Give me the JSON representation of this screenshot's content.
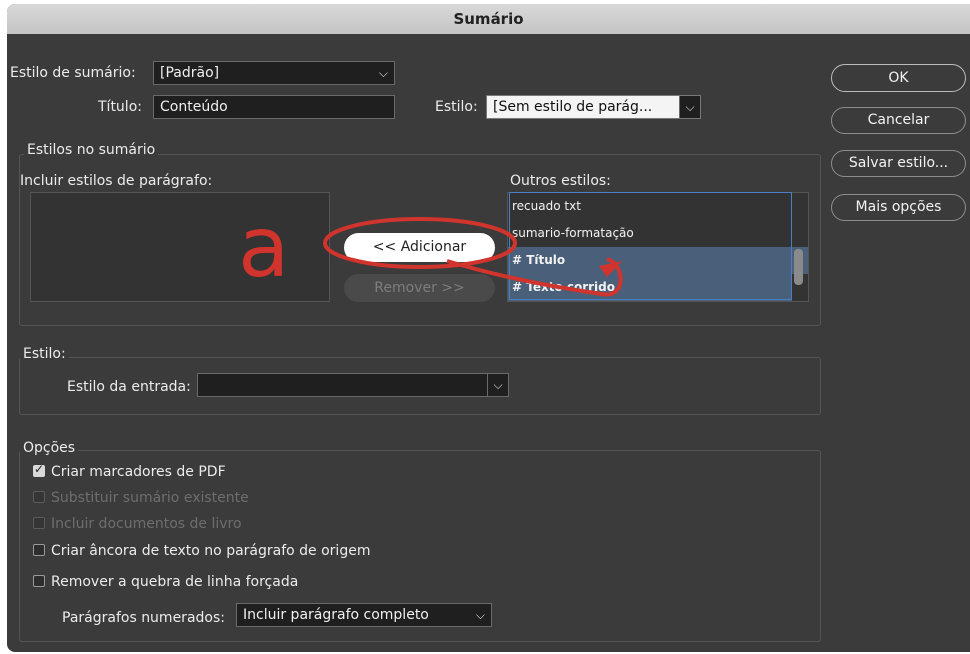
{
  "window": {
    "title": "Sumário"
  },
  "form": {
    "style_label": "Estilo de sumário:",
    "style_value": "[Padrão]",
    "title_label": "Título:",
    "title_value": "Conteúdo",
    "estilo_label": "Estilo:",
    "estilo_value": "[Sem estilo de parág..."
  },
  "buttons": {
    "ok": "OK",
    "cancel": "Cancelar",
    "save_style": "Salvar estilo...",
    "more_options": "Mais opções"
  },
  "styles_group": {
    "title": "Estilos no sumário",
    "include_label": "Incluir estilos de parágrafo:",
    "other_label": "Outros estilos:",
    "add_button": "<< Adicionar",
    "remove_button": "Remover >>",
    "other_items": [
      "recuado txt",
      "sumario-formatação",
      "# Título",
      "# Texto corrido"
    ],
    "selected_index": 2,
    "annotation_letter": "a"
  },
  "entry_group": {
    "title": "Estilo:",
    "entry_label": "Estilo da entrada:",
    "entry_value": ""
  },
  "options_group": {
    "title": "Opções",
    "items": [
      {
        "label": "Criar marcadores de PDF",
        "checked": true,
        "disabled": false
      },
      {
        "label": "Substituir sumário existente",
        "checked": false,
        "disabled": true
      },
      {
        "label": "Incluir documentos de livro",
        "checked": false,
        "disabled": true
      },
      {
        "label": "Criar âncora de texto no parágrafo de origem",
        "checked": false,
        "disabled": false
      },
      {
        "label": "Remover a quebra de linha forçada",
        "checked": false,
        "disabled": false
      }
    ],
    "numbered_label": "Parágrafos numerados:",
    "numbered_value": "Incluir parágrafo completo"
  },
  "colors": {
    "annotation": "#d0342c",
    "selection": "#4a5f7a"
  }
}
